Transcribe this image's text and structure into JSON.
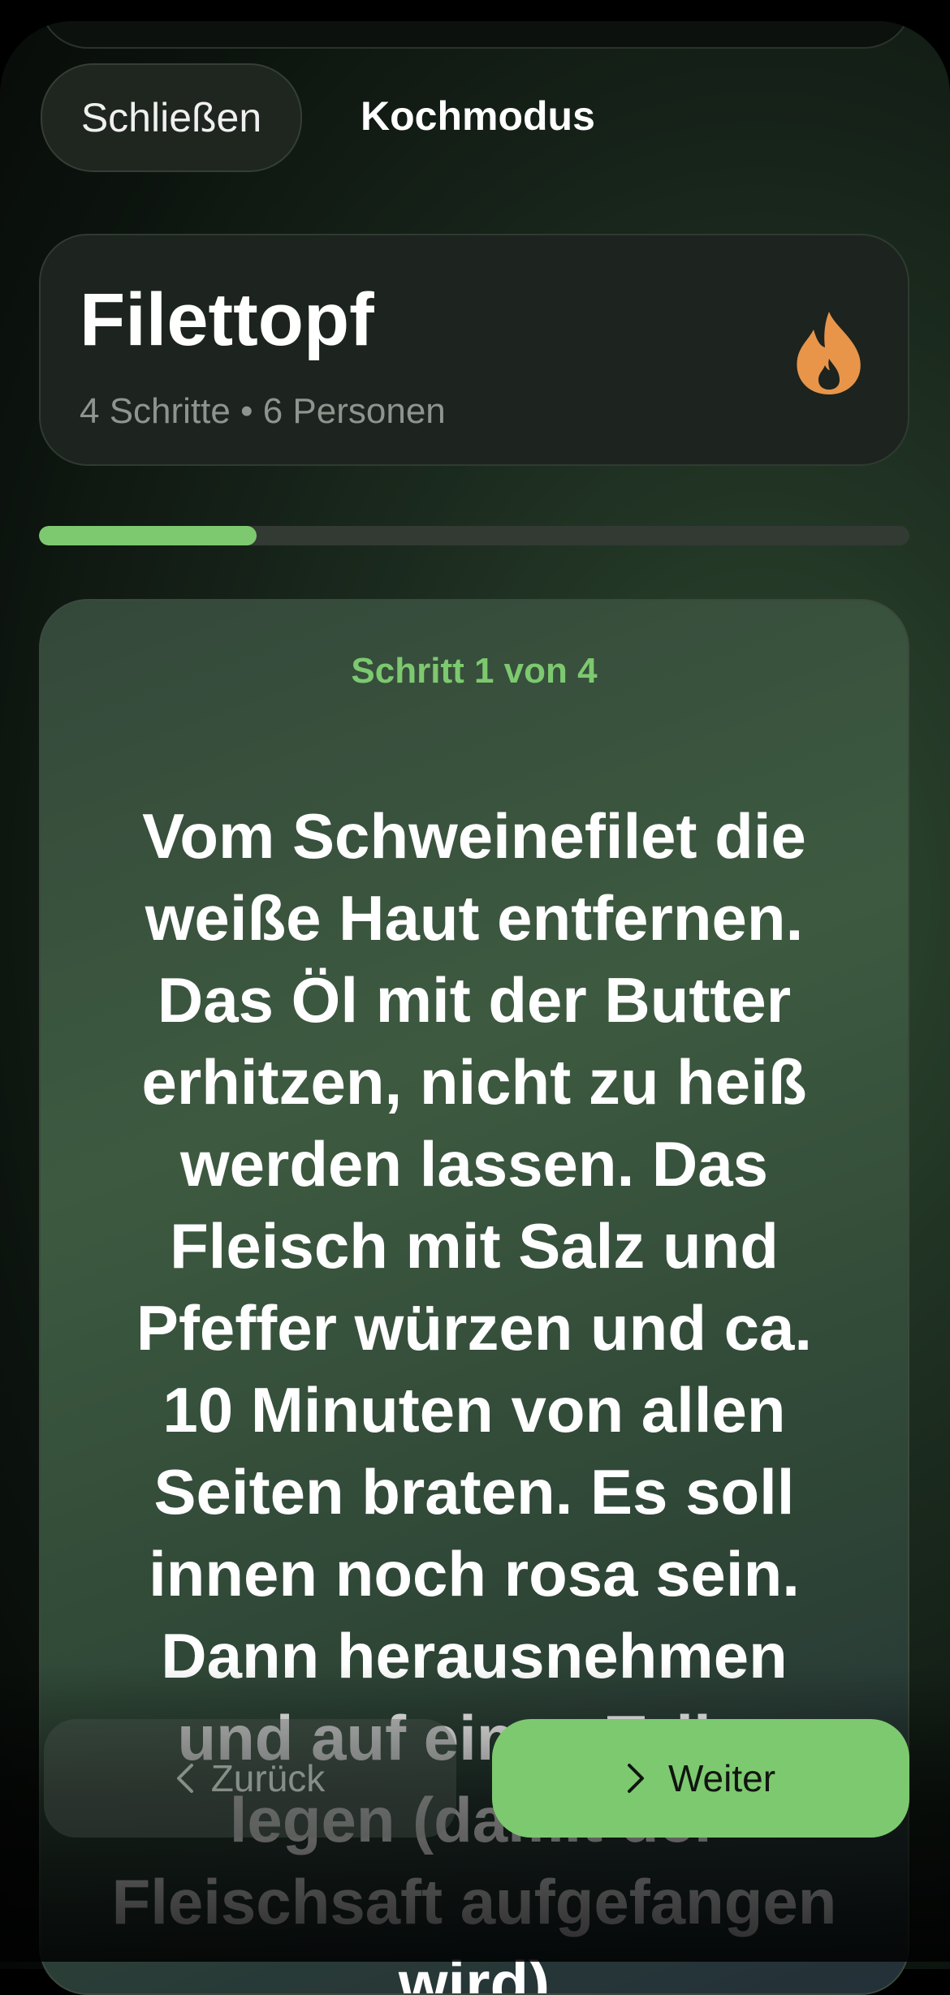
{
  "header": {
    "close_label": "Schließen",
    "mode_title": "Kochmodus"
  },
  "recipe": {
    "title": "Filettopf",
    "meta": "4 Schritte • 6 Personen",
    "icon": "flame-icon",
    "accent_color": "#E8954A"
  },
  "progress": {
    "current_step": 1,
    "total_steps": 4,
    "fraction": 0.25,
    "color": "#7DC96F"
  },
  "step": {
    "label": "Schritt 1 von 4",
    "text": "Vom Schweinefilet die weiße Haut entfernen. Das Öl mit der Butter erhitzen, nicht zu heiß werden lassen. Das Fleisch mit Salz und Pfeffer würzen und ca. 10 Minuten von allen Seiten braten. Es soll innen noch rosa sein. Dann herausnehmen und auf einen Teller legen (damit der Fleischsaft aufgefangen wird)"
  },
  "nav": {
    "back_label": "Zurück",
    "back_icon": "chevron-left-icon",
    "next_label": "Weiter",
    "next_icon": "chevron-right-icon"
  }
}
